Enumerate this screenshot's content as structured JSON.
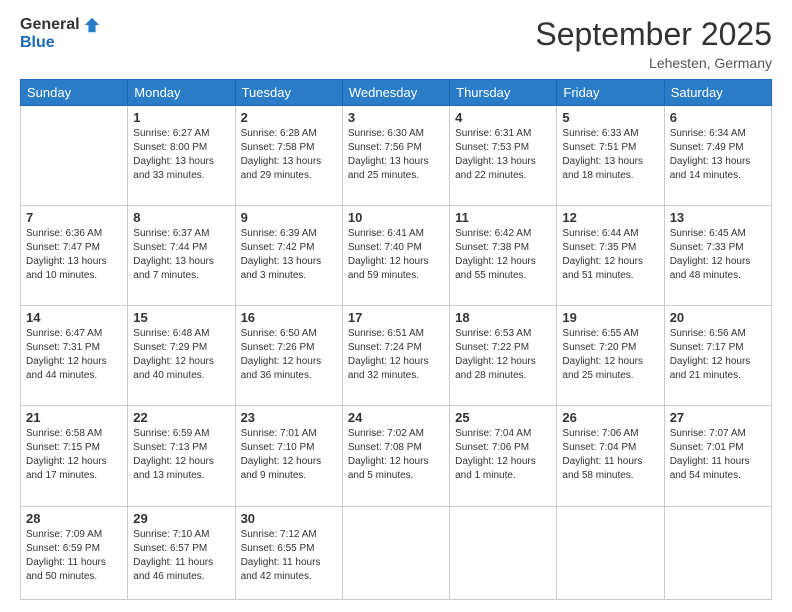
{
  "header": {
    "logo_general": "General",
    "logo_blue": "Blue",
    "month_title": "September 2025",
    "subtitle": "Lehesten, Germany"
  },
  "days_of_week": [
    "Sunday",
    "Monday",
    "Tuesday",
    "Wednesday",
    "Thursday",
    "Friday",
    "Saturday"
  ],
  "weeks": [
    [
      {
        "day": "",
        "sunrise": "",
        "sunset": "",
        "daylight": ""
      },
      {
        "day": "1",
        "sunrise": "Sunrise: 6:27 AM",
        "sunset": "Sunset: 8:00 PM",
        "daylight": "Daylight: 13 hours and 33 minutes."
      },
      {
        "day": "2",
        "sunrise": "Sunrise: 6:28 AM",
        "sunset": "Sunset: 7:58 PM",
        "daylight": "Daylight: 13 hours and 29 minutes."
      },
      {
        "day": "3",
        "sunrise": "Sunrise: 6:30 AM",
        "sunset": "Sunset: 7:56 PM",
        "daylight": "Daylight: 13 hours and 25 minutes."
      },
      {
        "day": "4",
        "sunrise": "Sunrise: 6:31 AM",
        "sunset": "Sunset: 7:53 PM",
        "daylight": "Daylight: 13 hours and 22 minutes."
      },
      {
        "day": "5",
        "sunrise": "Sunrise: 6:33 AM",
        "sunset": "Sunset: 7:51 PM",
        "daylight": "Daylight: 13 hours and 18 minutes."
      },
      {
        "day": "6",
        "sunrise": "Sunrise: 6:34 AM",
        "sunset": "Sunset: 7:49 PM",
        "daylight": "Daylight: 13 hours and 14 minutes."
      }
    ],
    [
      {
        "day": "7",
        "sunrise": "Sunrise: 6:36 AM",
        "sunset": "Sunset: 7:47 PM",
        "daylight": "Daylight: 13 hours and 10 minutes."
      },
      {
        "day": "8",
        "sunrise": "Sunrise: 6:37 AM",
        "sunset": "Sunset: 7:44 PM",
        "daylight": "Daylight: 13 hours and 7 minutes."
      },
      {
        "day": "9",
        "sunrise": "Sunrise: 6:39 AM",
        "sunset": "Sunset: 7:42 PM",
        "daylight": "Daylight: 13 hours and 3 minutes."
      },
      {
        "day": "10",
        "sunrise": "Sunrise: 6:41 AM",
        "sunset": "Sunset: 7:40 PM",
        "daylight": "Daylight: 12 hours and 59 minutes."
      },
      {
        "day": "11",
        "sunrise": "Sunrise: 6:42 AM",
        "sunset": "Sunset: 7:38 PM",
        "daylight": "Daylight: 12 hours and 55 minutes."
      },
      {
        "day": "12",
        "sunrise": "Sunrise: 6:44 AM",
        "sunset": "Sunset: 7:35 PM",
        "daylight": "Daylight: 12 hours and 51 minutes."
      },
      {
        "day": "13",
        "sunrise": "Sunrise: 6:45 AM",
        "sunset": "Sunset: 7:33 PM",
        "daylight": "Daylight: 12 hours and 48 minutes."
      }
    ],
    [
      {
        "day": "14",
        "sunrise": "Sunrise: 6:47 AM",
        "sunset": "Sunset: 7:31 PM",
        "daylight": "Daylight: 12 hours and 44 minutes."
      },
      {
        "day": "15",
        "sunrise": "Sunrise: 6:48 AM",
        "sunset": "Sunset: 7:29 PM",
        "daylight": "Daylight: 12 hours and 40 minutes."
      },
      {
        "day": "16",
        "sunrise": "Sunrise: 6:50 AM",
        "sunset": "Sunset: 7:26 PM",
        "daylight": "Daylight: 12 hours and 36 minutes."
      },
      {
        "day": "17",
        "sunrise": "Sunrise: 6:51 AM",
        "sunset": "Sunset: 7:24 PM",
        "daylight": "Daylight: 12 hours and 32 minutes."
      },
      {
        "day": "18",
        "sunrise": "Sunrise: 6:53 AM",
        "sunset": "Sunset: 7:22 PM",
        "daylight": "Daylight: 12 hours and 28 minutes."
      },
      {
        "day": "19",
        "sunrise": "Sunrise: 6:55 AM",
        "sunset": "Sunset: 7:20 PM",
        "daylight": "Daylight: 12 hours and 25 minutes."
      },
      {
        "day": "20",
        "sunrise": "Sunrise: 6:56 AM",
        "sunset": "Sunset: 7:17 PM",
        "daylight": "Daylight: 12 hours and 21 minutes."
      }
    ],
    [
      {
        "day": "21",
        "sunrise": "Sunrise: 6:58 AM",
        "sunset": "Sunset: 7:15 PM",
        "daylight": "Daylight: 12 hours and 17 minutes."
      },
      {
        "day": "22",
        "sunrise": "Sunrise: 6:59 AM",
        "sunset": "Sunset: 7:13 PM",
        "daylight": "Daylight: 12 hours and 13 minutes."
      },
      {
        "day": "23",
        "sunrise": "Sunrise: 7:01 AM",
        "sunset": "Sunset: 7:10 PM",
        "daylight": "Daylight: 12 hours and 9 minutes."
      },
      {
        "day": "24",
        "sunrise": "Sunrise: 7:02 AM",
        "sunset": "Sunset: 7:08 PM",
        "daylight": "Daylight: 12 hours and 5 minutes."
      },
      {
        "day": "25",
        "sunrise": "Sunrise: 7:04 AM",
        "sunset": "Sunset: 7:06 PM",
        "daylight": "Daylight: 12 hours and 1 minute."
      },
      {
        "day": "26",
        "sunrise": "Sunrise: 7:06 AM",
        "sunset": "Sunset: 7:04 PM",
        "daylight": "Daylight: 11 hours and 58 minutes."
      },
      {
        "day": "27",
        "sunrise": "Sunrise: 7:07 AM",
        "sunset": "Sunset: 7:01 PM",
        "daylight": "Daylight: 11 hours and 54 minutes."
      }
    ],
    [
      {
        "day": "28",
        "sunrise": "Sunrise: 7:09 AM",
        "sunset": "Sunset: 6:59 PM",
        "daylight": "Daylight: 11 hours and 50 minutes."
      },
      {
        "day": "29",
        "sunrise": "Sunrise: 7:10 AM",
        "sunset": "Sunset: 6:57 PM",
        "daylight": "Daylight: 11 hours and 46 minutes."
      },
      {
        "day": "30",
        "sunrise": "Sunrise: 7:12 AM",
        "sunset": "Sunset: 6:55 PM",
        "daylight": "Daylight: 11 hours and 42 minutes."
      },
      {
        "day": "",
        "sunrise": "",
        "sunset": "",
        "daylight": ""
      },
      {
        "day": "",
        "sunrise": "",
        "sunset": "",
        "daylight": ""
      },
      {
        "day": "",
        "sunrise": "",
        "sunset": "",
        "daylight": ""
      },
      {
        "day": "",
        "sunrise": "",
        "sunset": "",
        "daylight": ""
      }
    ]
  ]
}
